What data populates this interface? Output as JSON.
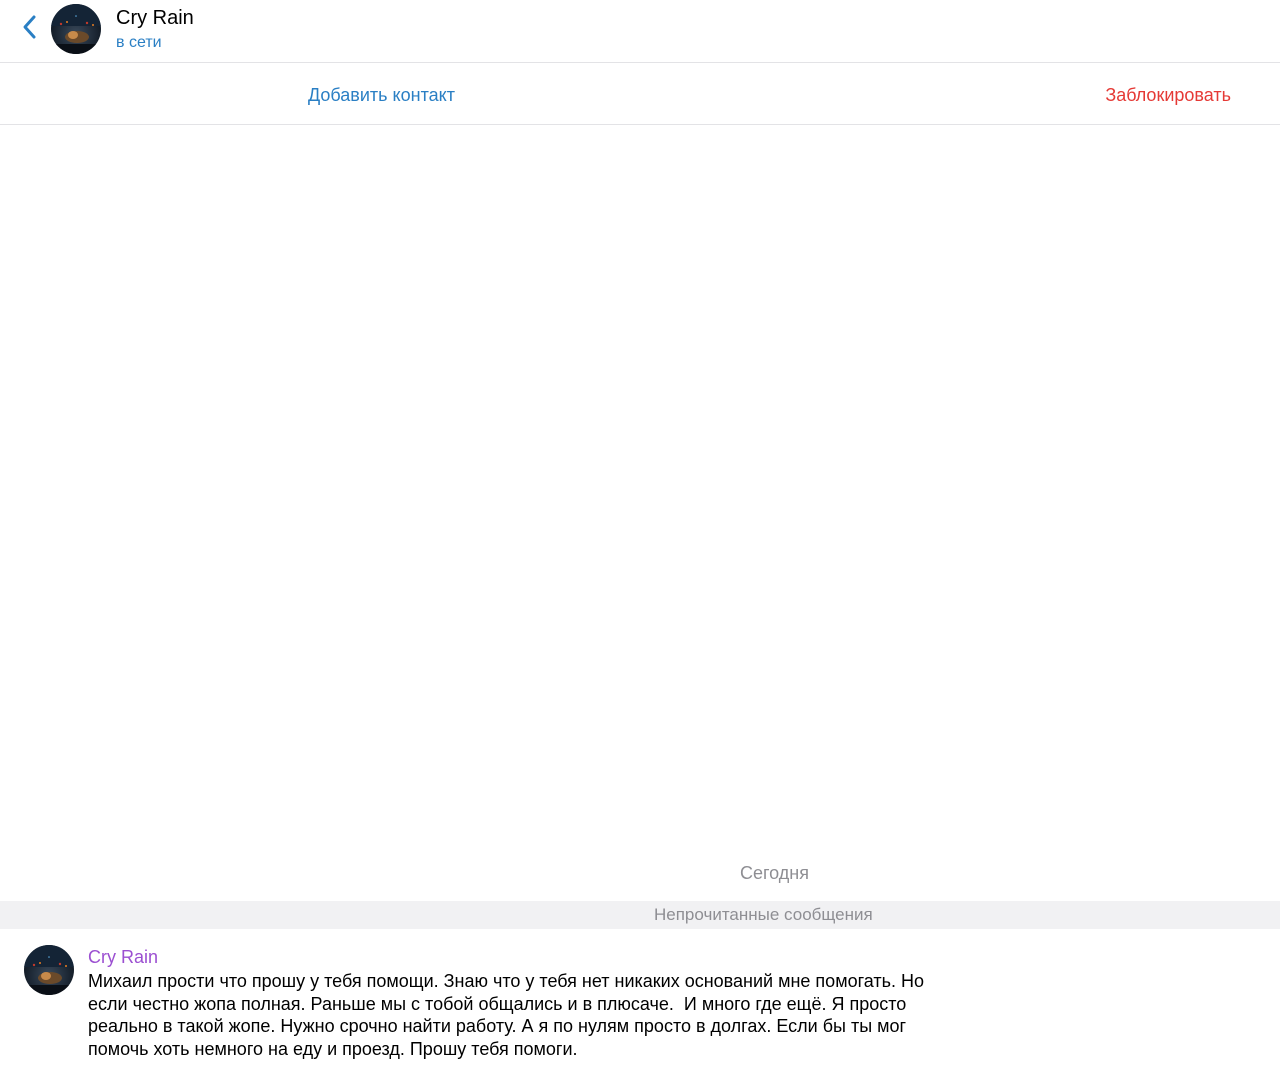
{
  "header": {
    "back_icon": "chevron-left-icon",
    "avatar_icon": "avatar-image",
    "title": "Cry Rain",
    "status": "в сети"
  },
  "action_bar": {
    "add_contact_label": "Добавить контакт",
    "block_label": "Заблокировать"
  },
  "chat": {
    "date_label": "Сегодня",
    "unread_label": "Непрочитанные сообщения",
    "messages": [
      {
        "author": "Cry Rain",
        "text": "Михаил прости что прошу у тебя помощи. Знаю что у тебя нет никаких оснований мне помогать. Но\nесли честно жопа полная. Раньше мы с тобой общались и в плюсаче.  И много где ещё. Я просто\nреально в такой жопе. Нужно срочно найти работу. А я по нулям просто в долгах. Если бы ты мог\nпомочь хоть немного на еду и проезд. Прошу тебя помоги."
      }
    ]
  },
  "colors": {
    "accent": "#2a7fc4",
    "danger": "#e53935",
    "author": "#9b4fd1",
    "muted": "#8e8e93",
    "divider": "#e3e3e6",
    "unread_bg": "#f1f1f3"
  }
}
